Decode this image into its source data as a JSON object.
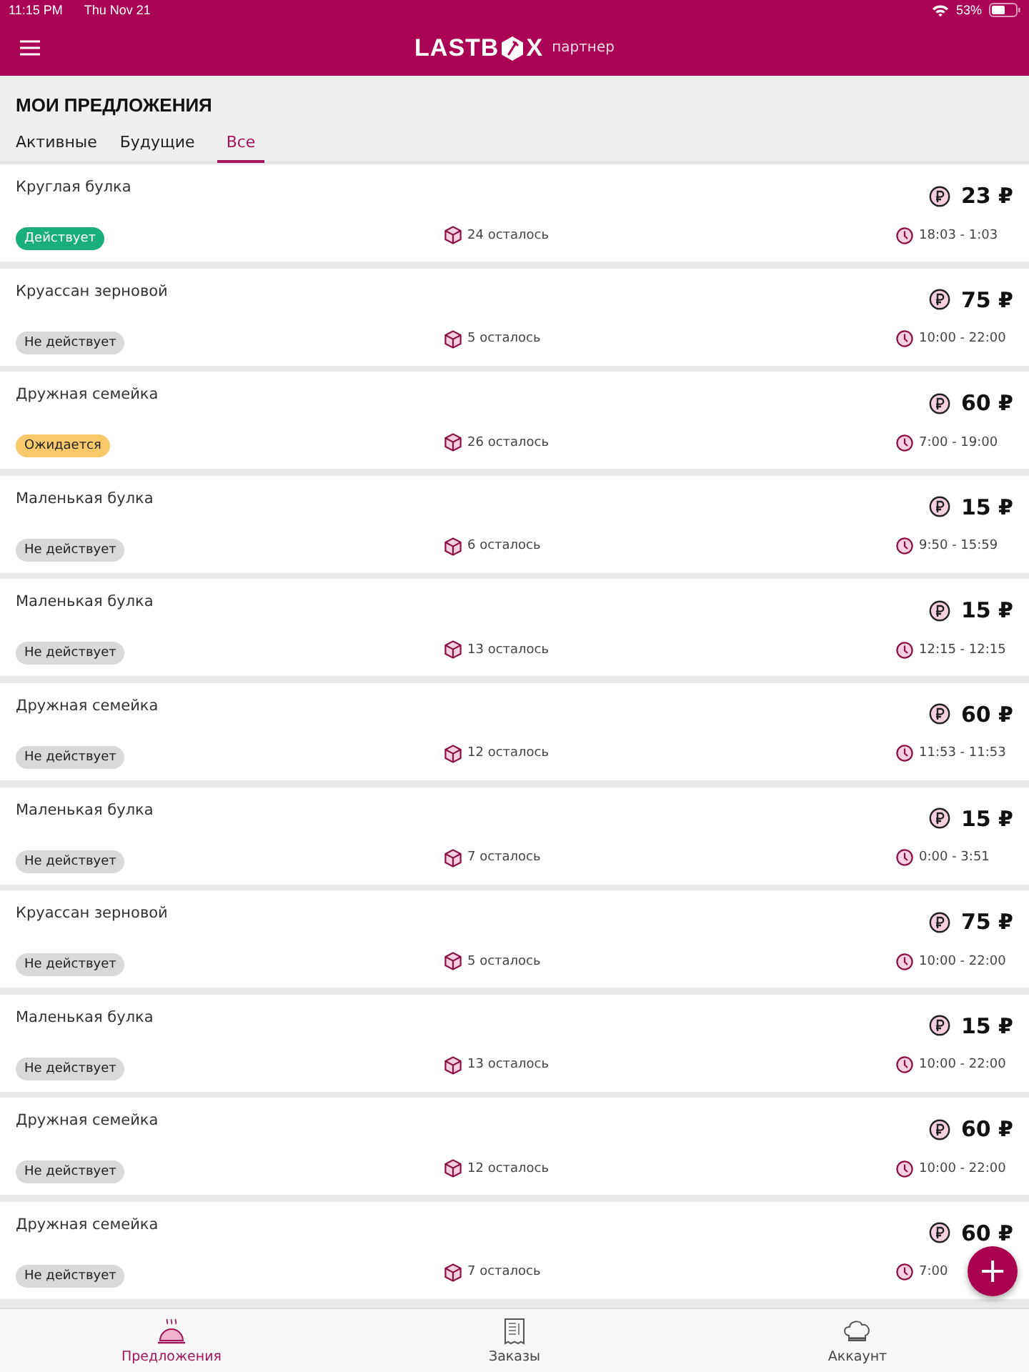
{
  "status_bar": {
    "time": "11:15 PM",
    "date": "Thu Nov 21",
    "battery": "53%"
  },
  "header": {
    "logo_start": "LASTB",
    "logo_end": "X",
    "subtitle": "партнер"
  },
  "page_title": "МОИ ПРЕДЛОЖЕНИЯ",
  "tabs": [
    {
      "label": "Активные",
      "selected": false
    },
    {
      "label": "Будущие",
      "selected": false
    },
    {
      "label": "Все",
      "selected": true
    }
  ],
  "offers": [
    {
      "name": "Круглая булка",
      "kind": "active",
      "status_label": "Действует",
      "left": "24 осталось",
      "price": "23 ₽",
      "time": "18:03 - 1:03"
    },
    {
      "name": "Круассан зерновой",
      "kind": "inactive",
      "status_label": "Не действует",
      "left": "5 осталось",
      "price": "75 ₽",
      "time": "10:00 - 22:00"
    },
    {
      "name": "Дружная семейка",
      "kind": "pending",
      "status_label": "Ожидается",
      "left": "26 осталось",
      "price": "60 ₽",
      "time": "7:00 - 19:00"
    },
    {
      "name": "Маленькая булка",
      "kind": "inactive",
      "status_label": "Не действует",
      "left": "6 осталось",
      "price": "15 ₽",
      "time": "9:50 - 15:59"
    },
    {
      "name": "Маленькая булка",
      "kind": "inactive",
      "status_label": "Не действует",
      "left": "13 осталось",
      "price": "15 ₽",
      "time": "12:15 - 12:15"
    },
    {
      "name": "Дружная семейка",
      "kind": "inactive",
      "status_label": "Не действует",
      "left": "12 осталось",
      "price": "60 ₽",
      "time": "11:53 - 11:53"
    },
    {
      "name": "Маленькая булка",
      "kind": "inactive",
      "status_label": "Не действует",
      "left": "7 осталось",
      "price": "15 ₽",
      "time": "0:00 - 3:51"
    },
    {
      "name": "Круассан зерновой",
      "kind": "inactive",
      "status_label": "Не действует",
      "left": "5 осталось",
      "price": "75 ₽",
      "time": "10:00 - 22:00"
    },
    {
      "name": "Маленькая булка",
      "kind": "inactive",
      "status_label": "Не действует",
      "left": "13 осталось",
      "price": "15 ₽",
      "time": "10:00 - 22:00"
    },
    {
      "name": "Дружная семейка",
      "kind": "inactive",
      "status_label": "Не действует",
      "left": "12 осталось",
      "price": "60 ₽",
      "time": "10:00 - 22:00"
    },
    {
      "name": "Дружная семейка",
      "kind": "inactive",
      "status_label": "Не действует",
      "left": "7 осталось",
      "price": "60 ₽",
      "time": "7:00"
    }
  ],
  "fab": {
    "label": "+"
  },
  "bottom_nav": [
    {
      "label": "Предложения",
      "kind": "offers",
      "selected": true
    },
    {
      "label": "Заказы",
      "kind": "orders",
      "selected": false
    },
    {
      "label": "Аккаунт",
      "kind": "account",
      "selected": false
    }
  ]
}
